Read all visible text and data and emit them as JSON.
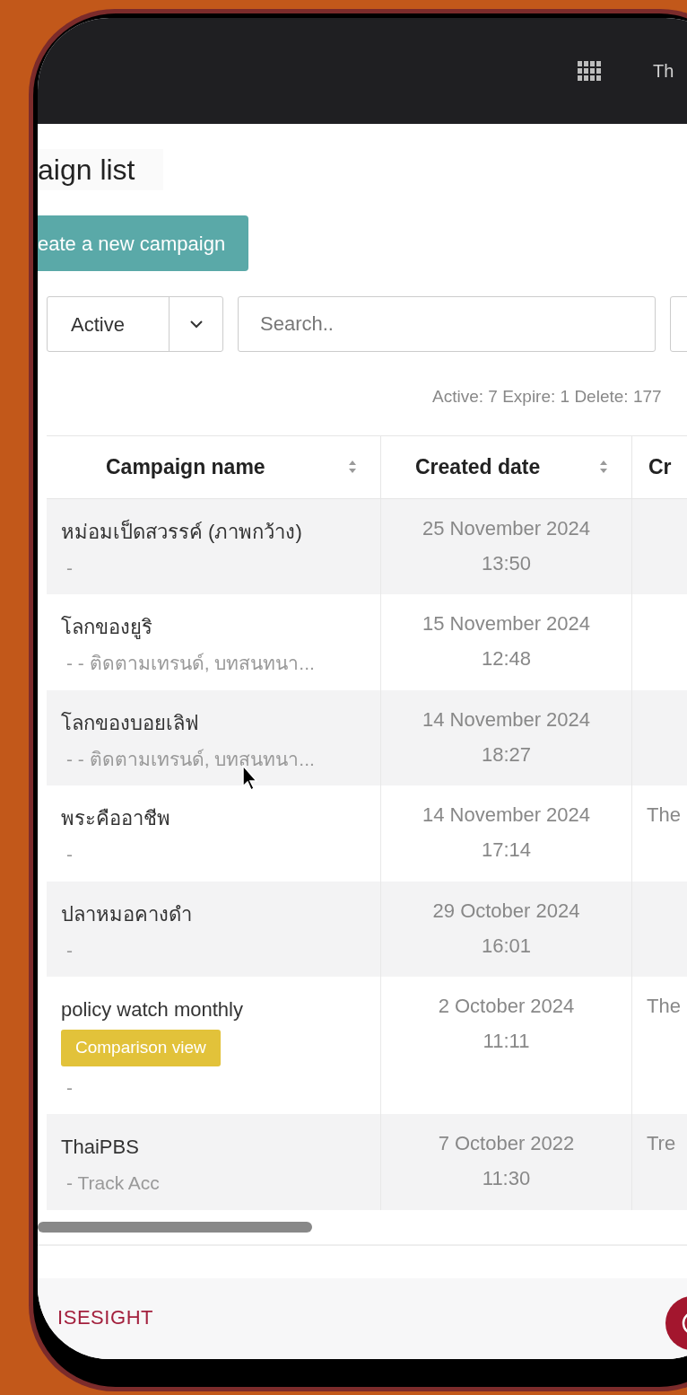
{
  "top_bar": {
    "user_label": "Th"
  },
  "page": {
    "title": "aign list",
    "create_button": "eate a new campaign",
    "status_filter": {
      "value": "Active"
    },
    "search": {
      "placeholder": "Search.."
    },
    "summary": "Active: 7 Expire: 1 Delete: 177"
  },
  "table": {
    "columns": [
      {
        "label": "Campaign name",
        "sortable": true
      },
      {
        "label": "Created date",
        "sortable": true
      },
      {
        "label": "Cr"
      }
    ],
    "rows": [
      {
        "name": "หม่อมเป็ดสวรรค์ (ภาพกว้าง)",
        "detail": "-",
        "date": "25 November 2024",
        "time": "13:50"
      },
      {
        "name": "โลกของยูริ",
        "detail": "- - ติดตามเทรนด์, บทสนทนา...",
        "date": "15 November 2024",
        "time": "12:48"
      },
      {
        "name": "โลกของบอยเลิฟ",
        "detail": "- - ติดตามเทรนด์, บทสนทนา...",
        "date": "14 November 2024",
        "time": "18:27"
      },
      {
        "name": "พระคืออาชีพ",
        "detail": "-",
        "date": "14 November 2024",
        "time": "17:14",
        "column_3": "The"
      },
      {
        "name": "ปลาหมอคางดำ",
        "detail": "-",
        "date": "29 October 2024",
        "time": "16:01"
      },
      {
        "name": "policy watch monthly",
        "tag": "Comparison view",
        "detail": "-",
        "date": "2 October 2024",
        "time": "11:11",
        "column_3": "The"
      },
      {
        "name": "ThaiPBS",
        "detail": "- Track Acc",
        "date": "7 October 2022",
        "time": "11:30",
        "column_3": "Tre"
      }
    ]
  },
  "footer": {
    "brand": "ISESIGHT"
  }
}
